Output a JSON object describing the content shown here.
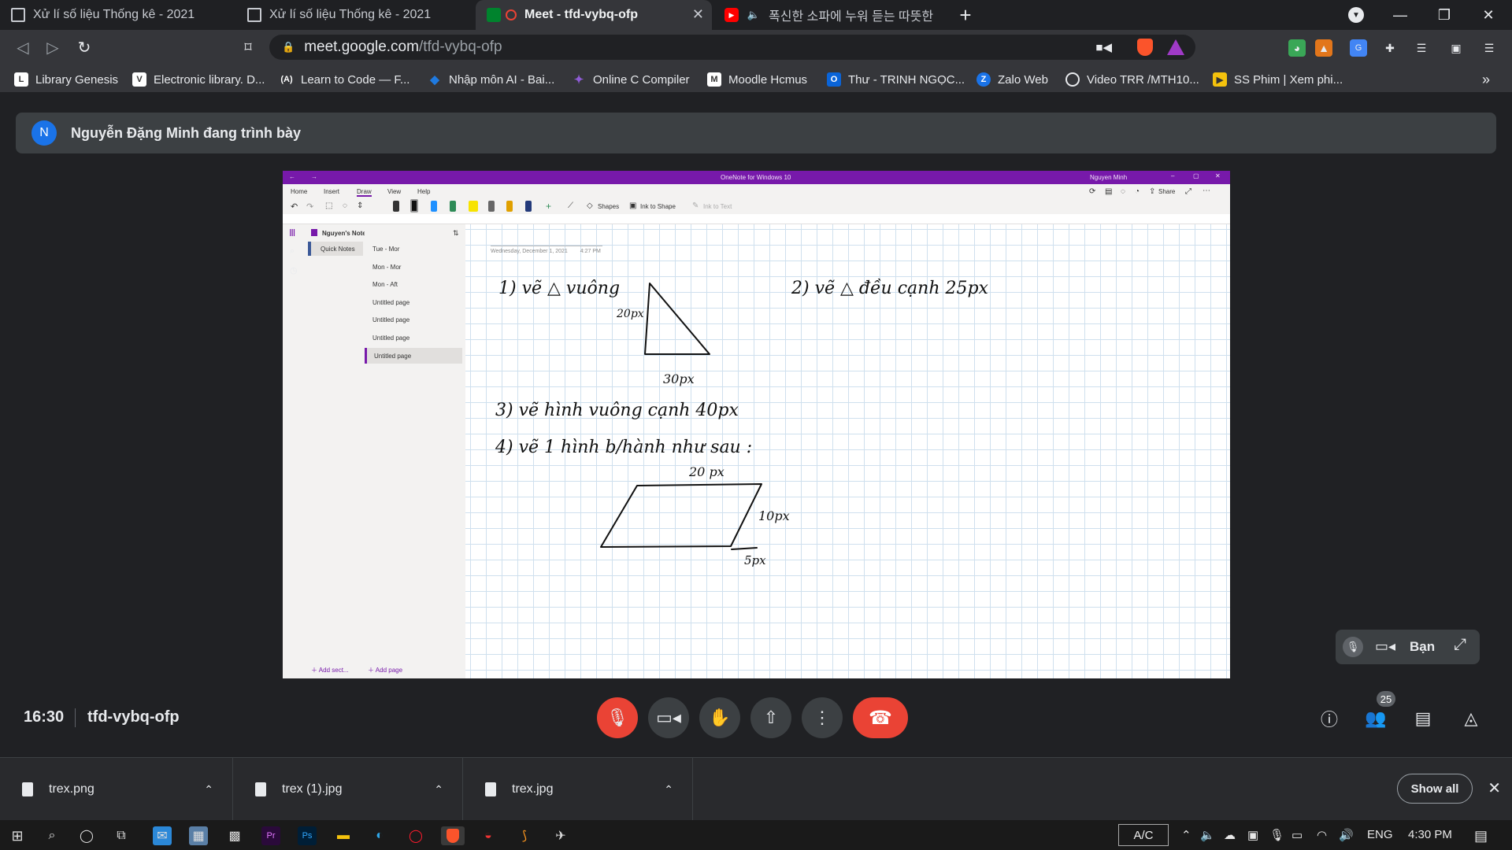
{
  "tabs": [
    {
      "title": "Xử lí số liệu Thống kê - 2021",
      "icon": "classroom-icon"
    },
    {
      "title": "Xử lí số liệu Thống kê - 2021",
      "icon": "classroom-icon"
    },
    {
      "title": "Meet - tfd-vybq-ofp",
      "icon": "meet-icon",
      "active": true
    },
    {
      "title": "폭신한 소파에 누워 듣는 따뜻한",
      "icon": "youtube-icon"
    }
  ],
  "address": {
    "host": "meet.google.com",
    "path": "/tfd-vybq-ofp"
  },
  "bookmarks": [
    {
      "label": "Library Genesis",
      "color": "#ffffff",
      "glyph": "L"
    },
    {
      "label": "Electronic library. D...",
      "color": "#ffffff",
      "glyph": "V"
    },
    {
      "label": "Learn to Code — F...",
      "color": "#ffffff",
      "glyph": "A"
    },
    {
      "label": "Nhập môn AI - Bai...",
      "color": "#1f7ae0",
      "glyph": "◆"
    },
    {
      "label": "Online C Compiler",
      "color": "#6f42c1",
      "glyph": "✦"
    },
    {
      "label": "Moodle Hcmus",
      "color": "#ffffff",
      "glyph": "M"
    },
    {
      "label": "Thư - TRINH NGỌC...",
      "color": "#0a64d8",
      "glyph": "O"
    },
    {
      "label": "Zalo Web",
      "color": "#1a73e8",
      "glyph": "Z"
    },
    {
      "label": "Video TRR /MTH10...",
      "color": "#ffffff",
      "glyph": "◎"
    },
    {
      "label": "SS Phim | Xem phi...",
      "color": "#f4c20d",
      "glyph": "▶"
    }
  ],
  "banner": {
    "avatar_letter": "N",
    "text": "Nguyễn Đặng Minh đang trình bày"
  },
  "onenote": {
    "window_title": "OneNote for Windows 10",
    "user": "Nguyen Minh",
    "menus": [
      "Home",
      "Insert",
      "Draw",
      "View",
      "Help"
    ],
    "active_menu": "Draw",
    "tools": {
      "shapes": "Shapes",
      "ink_to_shape": "Ink to Shape",
      "ink_to_text": "Ink to Text",
      "share": "Share"
    },
    "notebook": "Nguyen's Notebook",
    "section": "Quick Notes",
    "pages": [
      "Tue - Mor",
      "Mon - Mor",
      "Mon - Aft",
      "Untitled page",
      "Untitled page",
      "Untitled page",
      "Untitled page"
    ],
    "selected_page_index": 6,
    "add_section": "Add sect...",
    "add_page": "Add page",
    "page_date": "Wednesday, December 1, 2021",
    "page_time": "4:27 PM",
    "ink": {
      "line1": "1) vẽ △ vuông",
      "tri_left_label": "20px",
      "tri_bottom_label": "30px",
      "line2": "2) vẽ △ đều cạnh  25px",
      "line3": "3) vẽ hình vuông   cạnh 40px",
      "line4": "4) vẽ 1 hình b/hành  như sau :",
      "para_top_label": "20 px",
      "para_side_label": "10px",
      "para_offset_label": "5px"
    }
  },
  "pip": {
    "label": "Bạn"
  },
  "meeting": {
    "time": "16:30",
    "code": "tfd-vybq-ofp",
    "participants": "25"
  },
  "downloads": [
    {
      "name": "trex.png"
    },
    {
      "name": "trex (1).jpg"
    },
    {
      "name": "trex.jpg"
    }
  ],
  "download_show_all": "Show all",
  "taskbar": {
    "input": "A/C",
    "lang": "ENG",
    "clock": "4:30 PM"
  }
}
